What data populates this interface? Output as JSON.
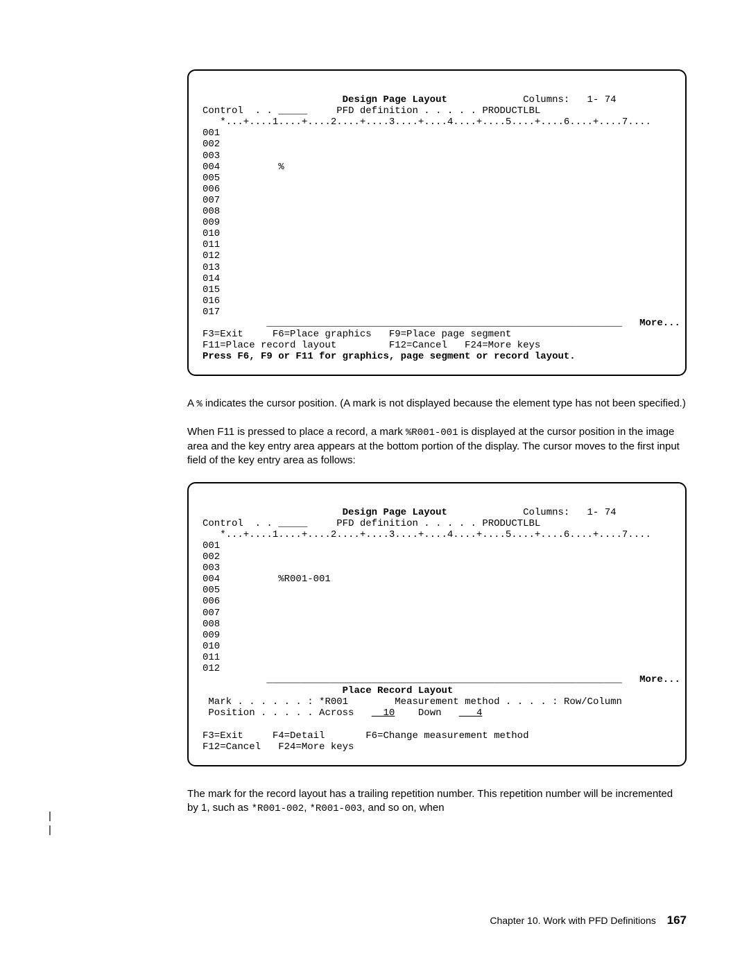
{
  "screen1": {
    "title": "Design Page Layout",
    "columns_label": "Columns:",
    "columns_value": "1- 74",
    "control_label": "Control  . .",
    "control_value": "_____",
    "pfd_label": "PFD definition . . . . .",
    "pfd_value": "PRODUCTLBL",
    "ruler": "   *...+....1....+....2....+....3....+....4....+....5....+....6....+....7....",
    "lines": [
      "001",
      "002",
      "003",
      "004          %",
      "005",
      "006",
      "007",
      "008",
      "009",
      "010",
      "011",
      "012",
      "013",
      "014",
      "015",
      "016",
      "017"
    ],
    "rule": "           _____________________________________________________________",
    "more": "More...",
    "fkeys1": "F3=Exit     F6=Place graphics   F9=Place page segment",
    "fkeys2": "F11=Place record layout         F12=Cancel   F24=More keys",
    "message": "Press F6, F9 or F11 for graphics, page segment or record layout."
  },
  "para1_pre": "A ",
  "para1_marker": "%",
  "para1_post": " indicates the cursor position.  (A mark is not displayed because the element type has not been specified.)",
  "para2_pre": "When F11 is pressed to place a record, a mark ",
  "para2_marker": "%R001-001",
  "para2_post": " is displayed at the cursor position in the image area and the key entry area appears at the bottom portion of the display.  The cursor moves to the first input field of the key entry area as follows:",
  "screen2": {
    "title": "Design Page Layout",
    "columns_label": "Columns:",
    "columns_value": "1- 74",
    "control_label": "Control  . .",
    "control_value": "_____",
    "pfd_label": "PFD definition . . . . .",
    "pfd_value": "PRODUCTLBL",
    "ruler": "   *...+....1....+....2....+....3....+....4....+....5....+....6....+....7....",
    "lines": [
      "001",
      "002",
      "003",
      "004          %R001-001",
      "005",
      "006",
      "007",
      "008",
      "009",
      "010",
      "011",
      "012"
    ],
    "rule": "           _____________________________________________________________",
    "more": "More...",
    "sub_title": "Place Record Layout",
    "mark_label": " Mark . . . . . . :",
    "mark_value": "*R001",
    "mm_label": "Measurement method . . . . :",
    "mm_value": "Row/Column",
    "pos_label": " Position . . . . .",
    "pos_across_label": "Across",
    "pos_across_value": "  10",
    "pos_down_label": "Down",
    "pos_down_value": "   4",
    "fkeys1": "F3=Exit     F4=Detail       F6=Change measurement method",
    "fkeys2": "F12=Cancel   F24=More keys"
  },
  "para3_a": "The mark for the record layout has a trailing repetition number.  This repetition number will be incremented by 1, such as ",
  "para3_m1": "*R001-002",
  "para3_b": ", ",
  "para3_m2": "*R001-003",
  "para3_c": ", and so on, when",
  "footer_chapter": "Chapter 10.  Work with PFD Definitions",
  "footer_page": "167"
}
